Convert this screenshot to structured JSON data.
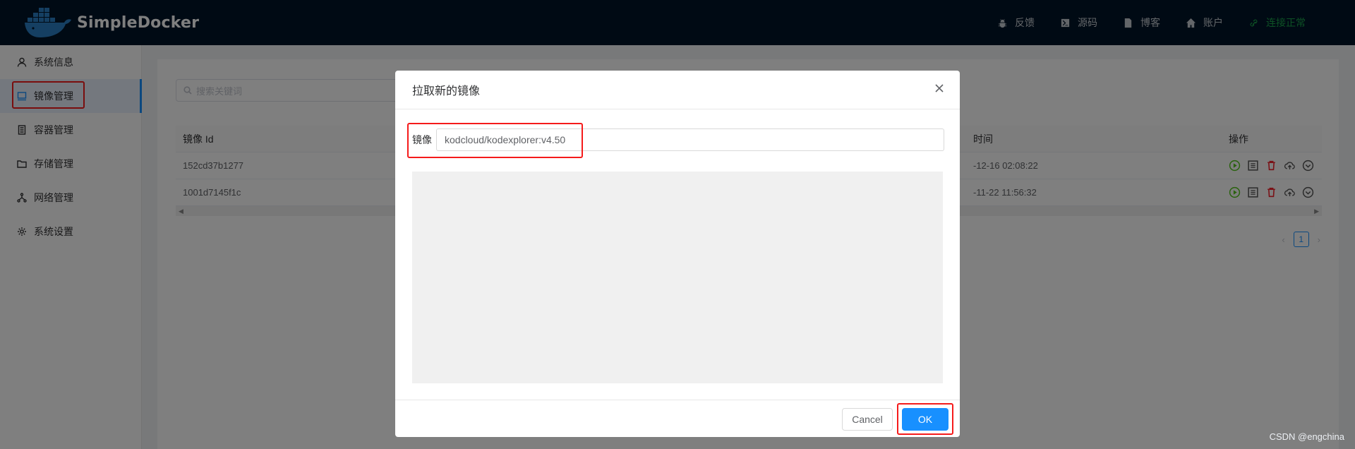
{
  "app": {
    "name": "SimpleDocker"
  },
  "topnav": {
    "items": [
      {
        "label": "反馈",
        "icon": "bug-icon"
      },
      {
        "label": "源码",
        "icon": "terminal-icon"
      },
      {
        "label": "博客",
        "icon": "file-icon"
      },
      {
        "label": "账户",
        "icon": "home-icon"
      }
    ],
    "status": {
      "label": "连接正常",
      "icon": "link-icon",
      "color": "#1aa34a"
    }
  },
  "sidebar": {
    "items": [
      {
        "label": "系统信息",
        "icon": "user-icon"
      },
      {
        "label": "镜像管理",
        "icon": "monitor-icon",
        "active": true
      },
      {
        "label": "容器管理",
        "icon": "document-icon"
      },
      {
        "label": "存储管理",
        "icon": "folder-icon"
      },
      {
        "label": "网络管理",
        "icon": "network-icon"
      },
      {
        "label": "系统设置",
        "icon": "gear-icon"
      }
    ]
  },
  "main": {
    "search_placeholder": "搜索关键词",
    "table": {
      "col_id": "镜像 Id",
      "col_time": "时间",
      "col_ops": "操作",
      "rows": [
        {
          "id": "152cd37b1277",
          "time": "-12-16 02:08:22"
        },
        {
          "id": "1001d7145f1c",
          "time": "-11-22 11:56:32"
        }
      ]
    },
    "pagination": {
      "prev": "‹",
      "current": "1",
      "next": "›"
    }
  },
  "modal": {
    "title": "拉取新的镜像",
    "image_label": "镜像",
    "image_value": "kodcloud/kodexplorer:v4.50",
    "cancel_label": "Cancel",
    "ok_label": "OK"
  },
  "colors": {
    "accent": "#1890ff",
    "highlight": "#f51b1b",
    "header_bg": "#001529"
  },
  "watermark": "CSDN @engchina"
}
